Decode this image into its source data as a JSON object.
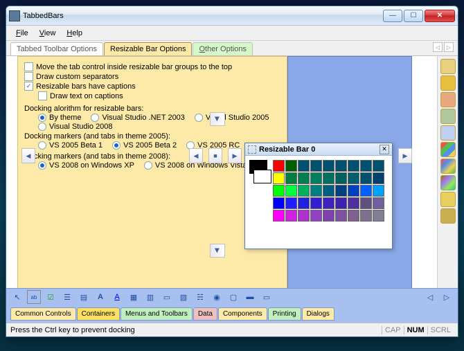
{
  "window": {
    "title": "TabbedBars"
  },
  "menu": {
    "file": "File",
    "view": "View",
    "help": "Help"
  },
  "tabs": {
    "items": [
      "Tabbed Toolbar Options",
      "Resizable Bar Options",
      "Other Options"
    ],
    "active": 1
  },
  "options": {
    "chk1": "Move the tab control inside resizable bar groups to the top",
    "chk2": "Draw custom separators",
    "chk3": "Resizable bars have captions",
    "chk4": "Draw text on captions",
    "sec1": "Docking alorithm for resizable bars:",
    "r1": "By theme",
    "r2": "Visual Studio .NET 2003",
    "r3": "Visual Studio 2005",
    "r4": "Visual Studio 2008",
    "sec2": "Docking markers (and tabs in theme 2005):",
    "r5": "VS 2005 Beta 1",
    "r6": "VS 2005 Beta 2",
    "r7": "VS 2005 RC",
    "sec3": "Docking markers (and tabs in theme 2008):",
    "r8": "VS 2008 on Windows XP",
    "r9": "VS 2008 on Windows Vista"
  },
  "palette": {
    "title": "Resizable Bar 0",
    "colors_row1": [
      "#ff0000",
      "#006000",
      "#005070",
      "#005070",
      "#005070",
      "#005070",
      "#005070",
      "#005070",
      "#005070"
    ],
    "colors_row2": [
      "#ffff00",
      "#008040",
      "#008050",
      "#008060",
      "#007060",
      "#006060",
      "#006070",
      "#005070",
      "#004070"
    ],
    "colors_row3": [
      "#00ff00",
      "#00ff40",
      "#00b060",
      "#008080",
      "#006080",
      "#004080",
      "#0040c0",
      "#0060ff",
      "#00a0ff"
    ],
    "colors_row4": [
      "#0000ff",
      "#2020ff",
      "#2020e0",
      "#3020d0",
      "#4020c0",
      "#4020b0",
      "#5030a0",
      "#605080",
      "#7060a0"
    ],
    "colors_row5": [
      "#ff00ff",
      "#d020e0",
      "#b030d0",
      "#9040c0",
      "#8040b0",
      "#8050a0",
      "#806090",
      "#807090",
      "#808090"
    ],
    "big1": "#000000",
    "big2": "#ffffff"
  },
  "categories": {
    "items": [
      "Common Controls",
      "Containers",
      "Menus and Toolbars",
      "Data",
      "Components",
      "Printing",
      "Dialogs"
    ],
    "colors": [
      "#fde9a8",
      "#fde060",
      "#c0f0c0",
      "#f0c0c0",
      "#fde9a8",
      "#c0f0c0",
      "#fde9a8"
    ]
  },
  "status": {
    "msg": "Press the Ctrl key to prevent docking",
    "cap": "CAP",
    "num": "NUM",
    "scrl": "SCRL"
  }
}
